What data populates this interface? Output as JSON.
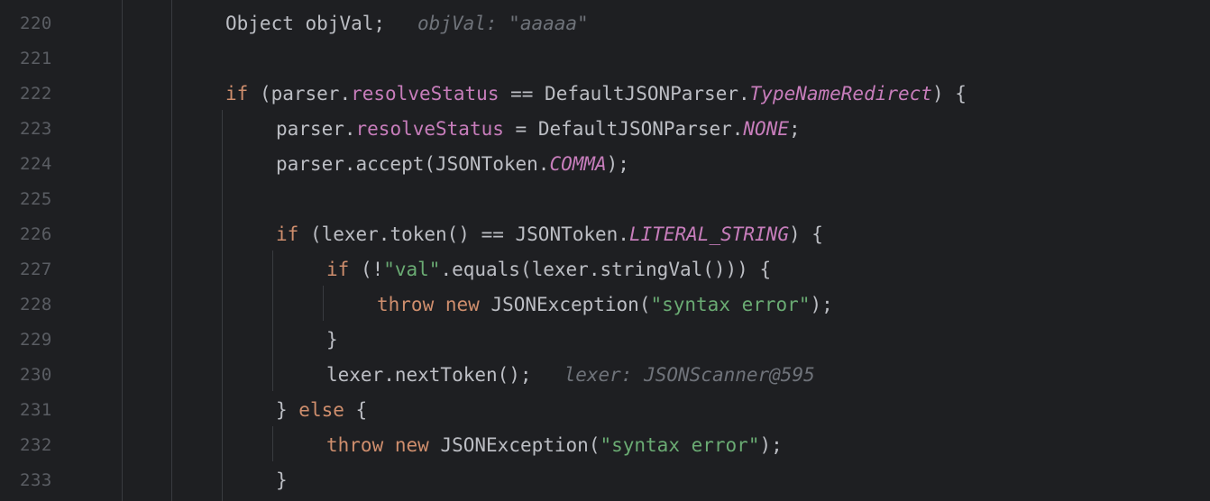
{
  "gutter": {
    "lines": [
      "220",
      "221",
      "222",
      "223",
      "224",
      "225",
      "226",
      "227",
      "228",
      "229",
      "230",
      "231",
      "232",
      "233"
    ]
  },
  "code": {
    "l220": {
      "type": "Object",
      "var": "objVal",
      "semi": ";",
      "hint": "objVal: \"aaaaa\""
    },
    "l222": {
      "kw_if": "if",
      "open": "(parser.",
      "field": "resolveStatus",
      "op": " == DefaultJSONParser.",
      "const": "TypeNameRedirect",
      "close": ") {"
    },
    "l223": {
      "pre": "parser.",
      "field": "resolveStatus",
      "mid": " = DefaultJSONParser.",
      "const": "NONE",
      "end": ";"
    },
    "l224": {
      "pre": "parser.accept(JSONToken.",
      "const": "COMMA",
      "end": ");"
    },
    "l226": {
      "kw_if": "if",
      "mid": " (lexer.token() == JSONToken.",
      "const": "LITERAL_STRING",
      "end": ") {"
    },
    "l227": {
      "kw_if": "if",
      "pre": " (!",
      "str": "\"val\"",
      "end": ".equals(lexer.stringVal())) {"
    },
    "l228": {
      "kw_throw": "throw",
      "kw_new": "new",
      "cls": " JSONException(",
      "str": "\"syntax error\"",
      "end": ");"
    },
    "l229": {
      "brace": "}"
    },
    "l230": {
      "call": "lexer.nextToken();",
      "hint": "lexer: JSONScanner@595"
    },
    "l231": {
      "brace": "} ",
      "kw_else": "else",
      "open": " {"
    },
    "l232": {
      "kw_throw": "throw",
      "kw_new": "new",
      "cls": " JSONException(",
      "str": "\"syntax error\"",
      "end": ");"
    },
    "l233": {
      "brace": "}"
    }
  },
  "colors": {
    "background": "#1e1f22",
    "keyword": "#cf8e6d",
    "field": "#c77dbb",
    "string": "#6aab73",
    "text": "#bcbec4",
    "line_number": "#5a5d63",
    "hint": "#6f737a"
  }
}
